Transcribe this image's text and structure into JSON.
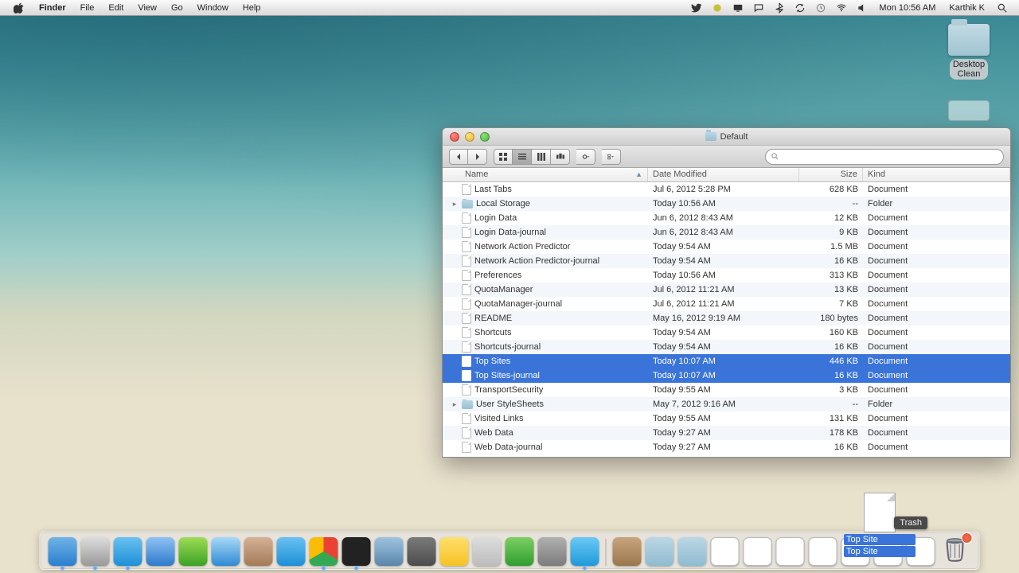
{
  "menubar": {
    "app": "Finder",
    "items": [
      "File",
      "Edit",
      "View",
      "Go",
      "Window",
      "Help"
    ],
    "clock": "Mon 10:56 AM",
    "user": "Karthik K"
  },
  "desktop": {
    "folder1_line1": "Desktop",
    "folder1_line2": "Clean"
  },
  "window": {
    "title": "Default",
    "columns": {
      "name": "Name",
      "date": "Date Modified",
      "size": "Size",
      "kind": "Kind"
    },
    "search_placeholder": ""
  },
  "files": [
    {
      "name": "Last Tabs",
      "date": "Jul 6, 2012 5:28 PM",
      "size": "628 KB",
      "kind": "Document",
      "type": "doc"
    },
    {
      "name": "Local Storage",
      "date": "Today 10:56 AM",
      "size": "--",
      "kind": "Folder",
      "type": "folder"
    },
    {
      "name": "Login Data",
      "date": "Jun 6, 2012 8:43 AM",
      "size": "12 KB",
      "kind": "Document",
      "type": "doc"
    },
    {
      "name": "Login Data-journal",
      "date": "Jun 6, 2012 8:43 AM",
      "size": "9 KB",
      "kind": "Document",
      "type": "doc"
    },
    {
      "name": "Network Action Predictor",
      "date": "Today 9:54 AM",
      "size": "1.5 MB",
      "kind": "Document",
      "type": "doc"
    },
    {
      "name": "Network Action Predictor-journal",
      "date": "Today 9:54 AM",
      "size": "16 KB",
      "kind": "Document",
      "type": "doc"
    },
    {
      "name": "Preferences",
      "date": "Today 10:56 AM",
      "size": "313 KB",
      "kind": "Document",
      "type": "doc"
    },
    {
      "name": "QuotaManager",
      "date": "Jul 6, 2012 11:21 AM",
      "size": "13 KB",
      "kind": "Document",
      "type": "doc"
    },
    {
      "name": "QuotaManager-journal",
      "date": "Jul 6, 2012 11:21 AM",
      "size": "7 KB",
      "kind": "Document",
      "type": "doc"
    },
    {
      "name": "README",
      "date": "May 16, 2012 9:19 AM",
      "size": "180 bytes",
      "kind": "Document",
      "type": "doc"
    },
    {
      "name": "Shortcuts",
      "date": "Today 9:54 AM",
      "size": "160 KB",
      "kind": "Document",
      "type": "doc"
    },
    {
      "name": "Shortcuts-journal",
      "date": "Today 9:54 AM",
      "size": "16 KB",
      "kind": "Document",
      "type": "doc"
    },
    {
      "name": "Top Sites",
      "date": "Today 10:07 AM",
      "size": "446 KB",
      "kind": "Document",
      "type": "doc",
      "selected": true
    },
    {
      "name": "Top Sites-journal",
      "date": "Today 10:07 AM",
      "size": "16 KB",
      "kind": "Document",
      "type": "doc",
      "selected": true
    },
    {
      "name": "TransportSecurity",
      "date": "Today 9:55 AM",
      "size": "3 KB",
      "kind": "Document",
      "type": "doc"
    },
    {
      "name": "User StyleSheets",
      "date": "May 7, 2012 9:16 AM",
      "size": "--",
      "kind": "Folder",
      "type": "folder"
    },
    {
      "name": "Visited Links",
      "date": "Today 9:55 AM",
      "size": "131 KB",
      "kind": "Document",
      "type": "doc"
    },
    {
      "name": "Web Data",
      "date": "Today 9:27 AM",
      "size": "178 KB",
      "kind": "Document",
      "type": "doc"
    },
    {
      "name": "Web Data-journal",
      "date": "Today 9:27 AM",
      "size": "16 KB",
      "kind": "Document",
      "type": "doc"
    }
  ],
  "drag": {
    "tooltip": "Trash",
    "label1": "Top Site",
    "label2": "Top Site"
  },
  "dock": [
    {
      "name": "finder",
      "cls": "app-finder",
      "running": true
    },
    {
      "name": "screenflow",
      "cls": "app-screenflow",
      "running": true
    },
    {
      "name": "twitter",
      "cls": "app-tw",
      "running": true
    },
    {
      "name": "itunes",
      "cls": "app-itunes"
    },
    {
      "name": "spotify",
      "cls": "app-spotify"
    },
    {
      "name": "appstore",
      "cls": "app-appstore"
    },
    {
      "name": "mail",
      "cls": "app-mx"
    },
    {
      "name": "safari",
      "cls": "app-tw"
    },
    {
      "name": "chrome",
      "cls": "app-chrome",
      "running": true
    },
    {
      "name": "activity",
      "cls": "app-htop",
      "running": true
    },
    {
      "name": "quicktime",
      "cls": "app-qt"
    },
    {
      "name": "settings",
      "cls": "app-gear"
    },
    {
      "name": "stickies",
      "cls": "app-notes"
    },
    {
      "name": "sketch",
      "cls": "app-draw"
    },
    {
      "name": "excel",
      "cls": "app-excel"
    },
    {
      "name": "sysprefs",
      "cls": "app-sys"
    },
    {
      "name": "tweetbot",
      "cls": "app-tweetbot",
      "running": true
    }
  ],
  "dock_right": [
    {
      "name": "box",
      "cls": "app-box"
    },
    {
      "name": "folder",
      "cls": "app-folder"
    },
    {
      "name": "folder2",
      "cls": "app-folder"
    },
    {
      "name": "doc1",
      "cls": "app-doc"
    },
    {
      "name": "doc2",
      "cls": "app-doc"
    },
    {
      "name": "doc3",
      "cls": "app-doc"
    },
    {
      "name": "doc4",
      "cls": "app-doc"
    },
    {
      "name": "doc5",
      "cls": "app-doc"
    },
    {
      "name": "doc6",
      "cls": "app-doc"
    },
    {
      "name": "doc7",
      "cls": "app-doc"
    }
  ]
}
